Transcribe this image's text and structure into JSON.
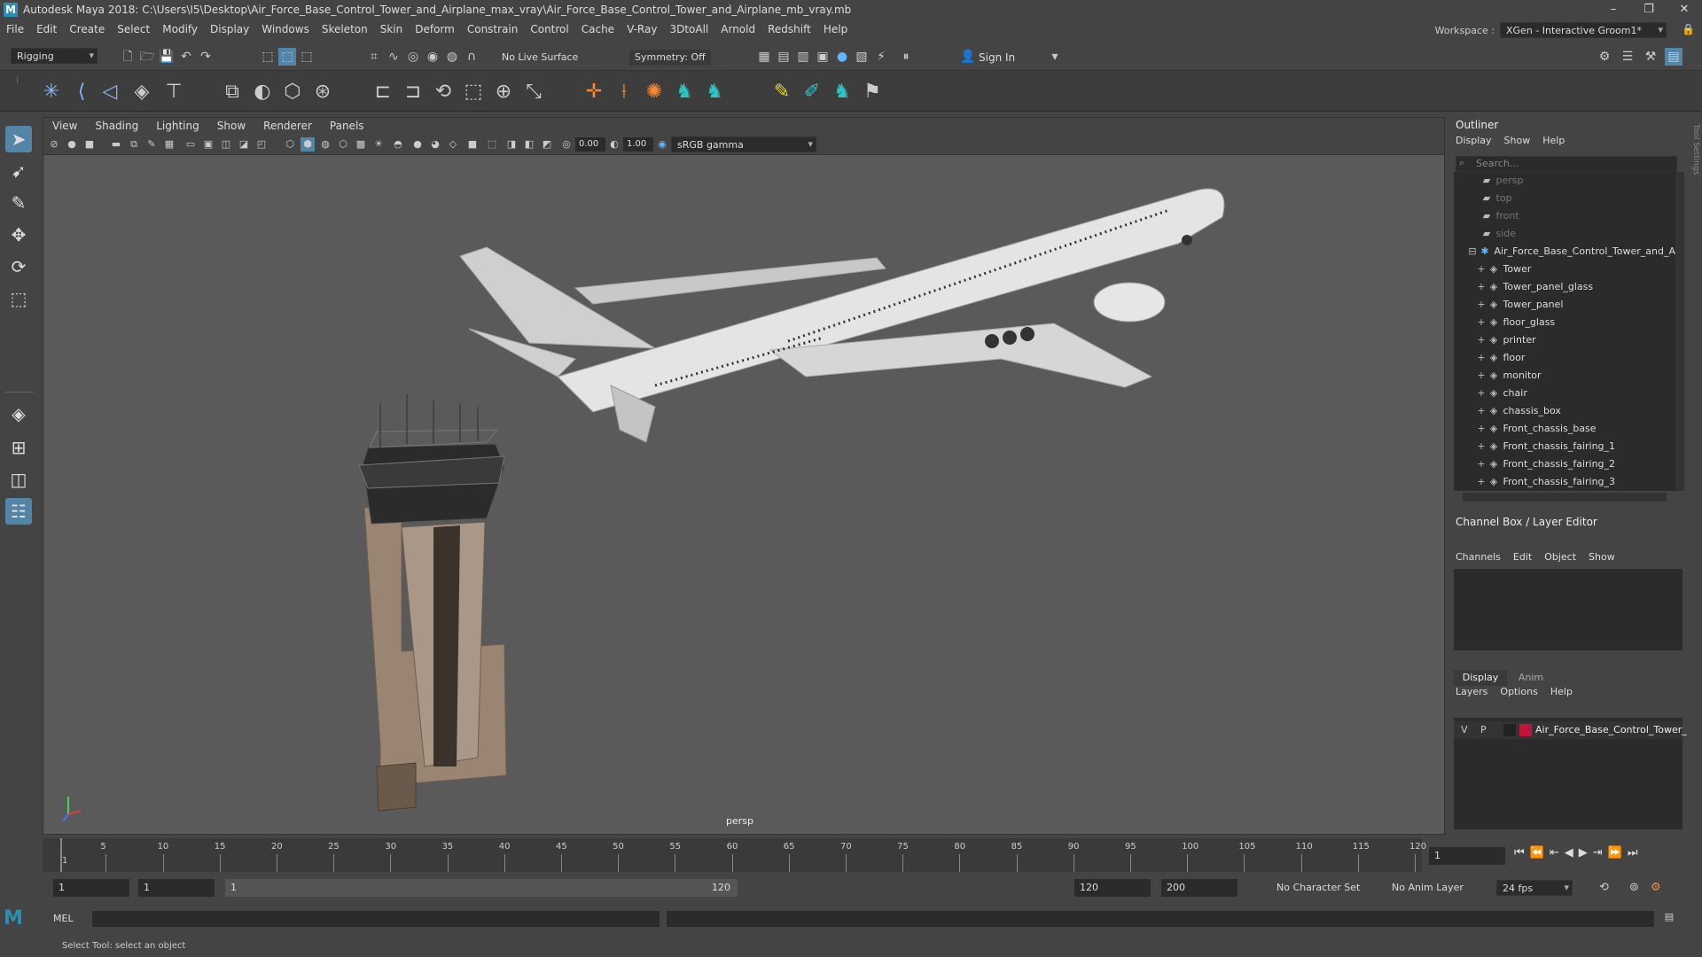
{
  "window": {
    "title": "Autodesk Maya 2018: C:\\Users\\I5\\Desktop\\Air_Force_Base_Control_Tower_and_Airplane_max_vray\\Air_Force_Base_Control_Tower_and_Airplane_mb_vray.mb",
    "logo": "M"
  },
  "menubar": [
    "File",
    "Edit",
    "Create",
    "Select",
    "Modify",
    "Display",
    "Windows",
    "Skeleton",
    "Skin",
    "Deform",
    "Constrain",
    "Control",
    "Cache",
    "V-Ray",
    "3DtoAll",
    "Arnold",
    "Redshift",
    "Help"
  ],
  "workspace": {
    "label": "Workspace :",
    "value": "XGen - Interactive Groom1*"
  },
  "statusline": {
    "mode": "Rigging",
    "live_surface": "No Live Surface",
    "symmetry": "Symmetry: Off",
    "sign_in": "Sign In"
  },
  "viewport": {
    "menu": [
      "View",
      "Shading",
      "Lighting",
      "Show",
      "Renderer",
      "Panels"
    ],
    "exposure": "0.00",
    "gamma": "1.00",
    "colorspace": "sRGB gamma",
    "camera_label": "persp"
  },
  "outliner": {
    "title": "Outliner",
    "menu": [
      "Display",
      "Show",
      "Help"
    ],
    "search_placeholder": "Search...",
    "cameras": [
      "persp",
      "top",
      "front",
      "side"
    ],
    "group": "Air_Force_Base_Control_Tower_and_A",
    "children": [
      "Tower",
      "Tower_panel_glass",
      "Tower_panel",
      "floor_glass",
      "printer",
      "floor",
      "monitor",
      "chair",
      "chassis_box",
      "Front_chassis_base",
      "Front_chassis_fairing_1",
      "Front_chassis_fairing_2",
      "Front_chassis_fairing_3"
    ]
  },
  "channelbox": {
    "title": "Channel Box / Layer Editor",
    "menu": [
      "Channels",
      "Edit",
      "Object",
      "Show"
    ],
    "tabs": [
      "Display",
      "Anim"
    ],
    "layer_menu": [
      "Layers",
      "Options",
      "Help"
    ],
    "layer": {
      "v": "V",
      "p": "P",
      "name": "Air_Force_Base_Control_Tower_",
      "color": "#c0163a"
    }
  },
  "timeline": {
    "ticks": [
      "1",
      "5",
      "10",
      "15",
      "20",
      "25",
      "30",
      "35",
      "40",
      "45",
      "50",
      "55",
      "60",
      "65",
      "70",
      "75",
      "80",
      "85",
      "90",
      "95",
      "100",
      "105",
      "110",
      "115",
      "120"
    ],
    "current_frame": "1"
  },
  "range": {
    "start": "1",
    "playback_start": "1",
    "slider_start": "1",
    "slider_end": "120",
    "playback_end": "120",
    "end": "200",
    "character_set": "No Character Set",
    "anim_layer": "No Anim Layer",
    "fps": "24 fps"
  },
  "cmdline": {
    "label": "MEL"
  },
  "helpline": "Select Tool: select an object"
}
